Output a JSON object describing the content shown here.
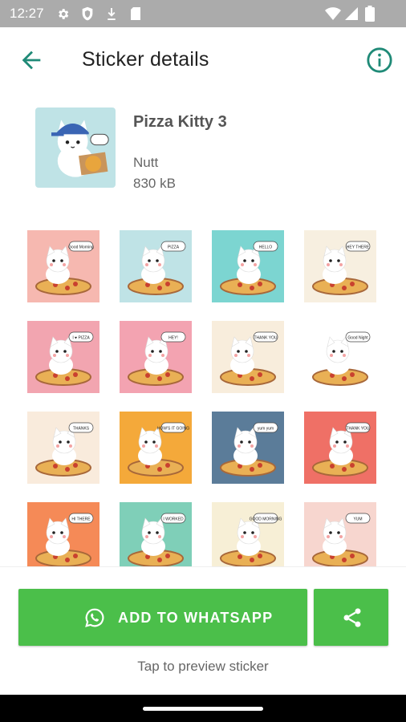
{
  "status": {
    "time": "12:27",
    "icons": [
      "settings-icon",
      "shield-icon",
      "download-icon",
      "sd-card-icon",
      "wifi-icon",
      "signal-icon",
      "battery-icon"
    ]
  },
  "appbar": {
    "title": "Sticker details",
    "back_icon": "arrow-back-icon",
    "info_icon": "info-icon",
    "accent": "#1f8a77"
  },
  "pack": {
    "name": "Pizza Kitty 3",
    "author": "Nutt",
    "size": "830 kB"
  },
  "stickers": [
    {
      "bg": "#f6b8b0",
      "caption": "Good Morning"
    },
    {
      "bg": "#bfe3e6",
      "caption": "PIZZA"
    },
    {
      "bg": "#7cd5d1",
      "caption": "HELLO"
    },
    {
      "bg": "#f7efe0",
      "caption": "HEY THERE"
    },
    {
      "bg": "#f2a5b0",
      "caption": "I ♥ PIZZA"
    },
    {
      "bg": "#f3a3b1",
      "caption": "HEY!"
    },
    {
      "bg": "#f8eddc",
      "caption": "THANK YOU"
    },
    {
      "bg": "#ffffff",
      "caption": "Good Night"
    },
    {
      "bg": "#f9ebdc",
      "caption": "THANKS"
    },
    {
      "bg": "#f4a93a",
      "caption": "HOW'S IT GOING"
    },
    {
      "bg": "#5b7c99",
      "caption": "yum yum"
    },
    {
      "bg": "#ef7066",
      "caption": "THANK YOU"
    },
    {
      "bg": "#f58a57",
      "caption": "HI THERE"
    },
    {
      "bg": "#7fcfb8",
      "caption": "I WORKED"
    },
    {
      "bg": "#f7efd6",
      "caption": "GOOD MORNING"
    },
    {
      "bg": "#f7d6cf",
      "caption": "YUM"
    }
  ],
  "actions": {
    "add_label": "ADD TO WHATSAPP",
    "add_icon": "whatsapp-icon",
    "share_icon": "share-icon",
    "button_color": "#4bbf4a"
  },
  "hint": "Tap to preview sticker"
}
